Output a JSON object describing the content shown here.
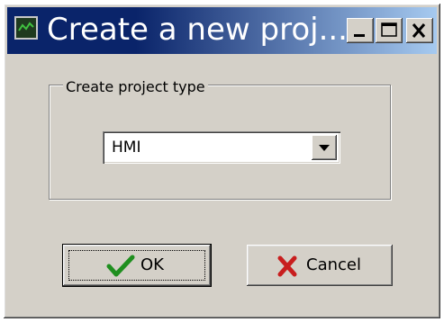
{
  "window": {
    "title": "Create a new proj...",
    "minimize_icon": "minimize-icon",
    "maximize_icon": "maximize-icon",
    "close_icon": "close-icon",
    "app_icon": "app-monitor-icon"
  },
  "group": {
    "legend": "Create project type"
  },
  "project_type": {
    "selected": "HMI",
    "icon": "chevron-down-icon"
  },
  "buttons": {
    "ok_label": "OK",
    "ok_icon": "checkmark-icon",
    "cancel_label": "Cancel",
    "cancel_icon": "x-icon"
  },
  "colors": {
    "face": "#d4d0c8",
    "title_start": "#0a246a",
    "title_end": "#a6caf0",
    "check": "#1f8f1f",
    "cross": "#c81e1e"
  }
}
